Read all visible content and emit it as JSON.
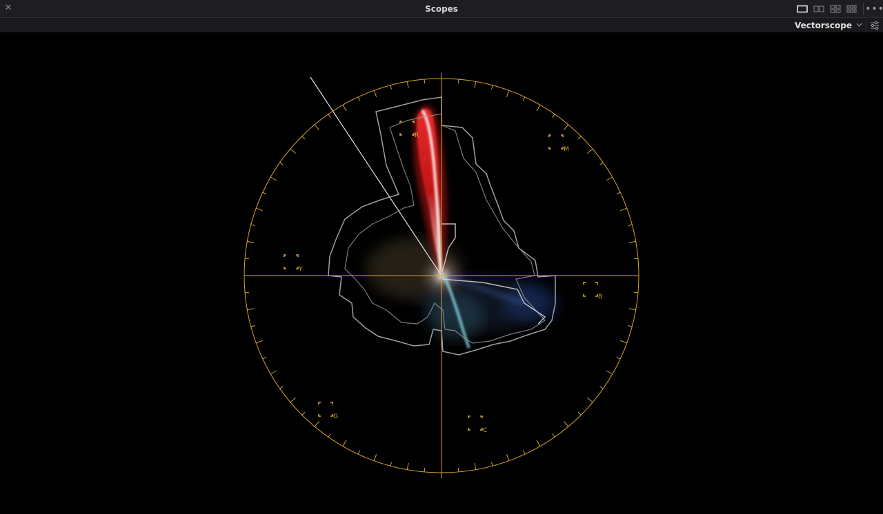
{
  "window": {
    "title": "Scopes"
  },
  "toolbar": {
    "scope_type": "Vectorscope"
  },
  "icons": {
    "close": "close-icon",
    "layout_single": "layout-single-icon",
    "layout_dual": "layout-dual-icon",
    "layout_quad": "layout-quad-icon",
    "layout_multi": "layout-multi-icon",
    "more": "more-options-icon",
    "chevron": "chevron-down-icon",
    "settings": "settings-sliders-icon"
  },
  "graticule": {
    "color": "#d4a72c",
    "targets": [
      {
        "key": "R",
        "label": "R"
      },
      {
        "key": "M",
        "label": "M"
      },
      {
        "key": "B",
        "label": "B"
      },
      {
        "key": "C",
        "label": "C"
      },
      {
        "key": "G",
        "label": "G"
      },
      {
        "key": "Y",
        "label": "Y"
      }
    ]
  }
}
